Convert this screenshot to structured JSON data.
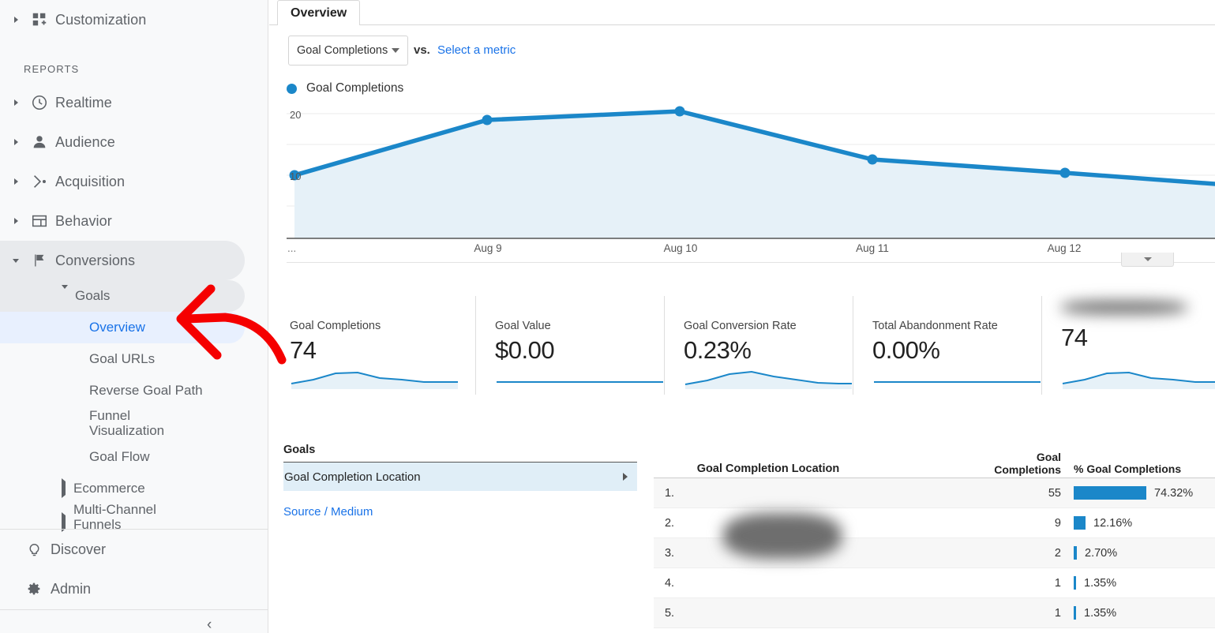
{
  "sidebar": {
    "top_items": [
      {
        "label": "Customization",
        "icon": "customization-icon",
        "expandable": true
      }
    ],
    "section_header": "REPORTS",
    "report_items": [
      {
        "label": "Realtime",
        "icon": "clock-icon",
        "expandable": true
      },
      {
        "label": "Audience",
        "icon": "person-icon",
        "expandable": true
      },
      {
        "label": "Acquisition",
        "icon": "share-icon",
        "expandable": true
      },
      {
        "label": "Behavior",
        "icon": "window-icon",
        "expandable": true
      },
      {
        "label": "Conversions",
        "icon": "flag-icon",
        "expandable": true,
        "expanded": true,
        "active_group": true
      }
    ],
    "goals_group": {
      "label": "Goals",
      "expanded": true,
      "children": [
        {
          "label": "Overview",
          "active": true
        },
        {
          "label": "Goal URLs",
          "active": false
        },
        {
          "label": "Reverse Goal Path",
          "active": false
        },
        {
          "label": "Funnel Visualization",
          "active": false
        },
        {
          "label": "Goal Flow",
          "active": false
        }
      ]
    },
    "sibling_groups": [
      {
        "label": "Ecommerce",
        "expandable": true
      },
      {
        "label": "Multi-Channel Funnels",
        "expandable": true
      }
    ],
    "bottom_items": [
      {
        "label": "Discover",
        "icon": "lightbulb-icon"
      },
      {
        "label": "Admin",
        "icon": "gear-icon"
      }
    ],
    "collapse_icon": "chevron-left-icon"
  },
  "main": {
    "tab_label": "Overview",
    "metric_selector": {
      "value": "Goal Completions",
      "caret_icon": "chevron-down-icon"
    },
    "vs_label": "vs.",
    "select_metric_link": "Select a metric",
    "legend": {
      "label": "Goal Completions",
      "color": "#1b87c9"
    },
    "chart_collapse_icon": "chevron-down-icon"
  },
  "chart_data": {
    "type": "area",
    "title": "Goal Completions",
    "xlabel": "",
    "ylabel": "",
    "ylim": [
      0,
      25
    ],
    "yticks": [
      10,
      20
    ],
    "grid": true,
    "legend_position": "top-left",
    "line_color": "#1b87c9",
    "fill_color": "#e6f1f8",
    "axis_truncated_left_label": "...",
    "categories": [
      "",
      "Aug 9",
      "Aug 10",
      "Aug 11",
      "Aug 12",
      ""
    ],
    "x_tick_labels": [
      "Aug 9",
      "Aug 10",
      "Aug 11",
      "Aug 12"
    ],
    "series": [
      {
        "name": "Goal Completions",
        "values": [
          10,
          18,
          20,
          14,
          11,
          9
        ]
      }
    ]
  },
  "kpis": [
    {
      "title": "Goal Completions",
      "value": "74",
      "spark": "curve",
      "redacted_title": false
    },
    {
      "title": "Goal Value",
      "value": "$0.00",
      "spark": "flat",
      "redacted_title": false
    },
    {
      "title": "Goal Conversion Rate",
      "value": "0.23%",
      "spark": "curve",
      "redacted_title": false
    },
    {
      "title": "Total Abandonment Rate",
      "value": "0.00%",
      "spark": "flat",
      "redacted_title": false
    },
    {
      "title": "",
      "value": "74",
      "spark": "curve",
      "redacted_title": true
    }
  ],
  "goals_panel": {
    "header": "Goals",
    "selected_item": "Goal Completion Location",
    "selected_caret_icon": "chevron-right-icon",
    "link": "Source / Medium"
  },
  "table": {
    "columns": {
      "dimension": "Goal Completion Location",
      "metric": "Goal\nCompletions",
      "metric_line1": "Goal",
      "metric_line2": "Completions",
      "percent": "% Goal Completions"
    },
    "rows": [
      {
        "index": "1.",
        "location": "",
        "redacted": true,
        "completions": "55",
        "percent": "74.32%",
        "bar_pct": 74.32
      },
      {
        "index": "2.",
        "location": "",
        "redacted": true,
        "completions": "9",
        "percent": "12.16%",
        "bar_pct": 12.16
      },
      {
        "index": "3.",
        "location": "",
        "redacted": true,
        "completions": "2",
        "percent": "2.70%",
        "bar_pct": 2.7
      },
      {
        "index": "4.",
        "location": "",
        "redacted": true,
        "completions": "1",
        "percent": "1.35%",
        "bar_pct": 1.35
      },
      {
        "index": "5.",
        "location": "",
        "redacted": true,
        "completions": "1",
        "percent": "1.35%",
        "bar_pct": 1.35
      }
    ]
  },
  "annotation": {
    "type": "hand-drawn-arrow",
    "color": "#f50000",
    "points_to": "Overview"
  }
}
